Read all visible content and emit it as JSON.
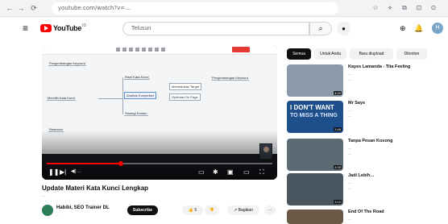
{
  "browser": {
    "address": "youtube.com/watch?v=…",
    "back_icon": "←",
    "forward_icon": "→",
    "reload_icon": "⟳",
    "ext_icons": [
      "☆",
      "⋄",
      "⧉",
      "⊡",
      "⊙"
    ]
  },
  "header": {
    "menu_icon": "≡",
    "logo_text": "YouTube",
    "logo_country": "ID",
    "search_placeholder": "Telusuri",
    "search_icon": "⌕",
    "mic_icon": "●",
    "create_icon": "⊕",
    "bell_icon": "🔔"
  },
  "player": {
    "time": "…",
    "mindmap": {
      "nodes": [
        "Pengembangan Keyword",
        "Memilih Kata Kunci",
        "Research",
        "Riset Kata Kunci",
        "Analisis Kompetitor",
        "Strategi Konten",
        "Menentukan Target",
        "Optimasi On Page"
      ]
    },
    "progress": 0.33,
    "controls": {
      "play_icon": "❚❚",
      "next_icon": "▶|",
      "volume_icon": "◀)",
      "subtitles_icon": "▭",
      "settings_icon": "✱",
      "miniplayer_icon": "▣",
      "theater_icon": "▭",
      "fullscreen_icon": "⛶"
    }
  },
  "video": {
    "title": "Update Materi Kata Kunci Lengkap",
    "subline": "…",
    "channel_name": "Habibi, SEO Trainer DL",
    "channel_subs": "…",
    "subscribe_label": "Subscribe",
    "likes_label": "👍 5",
    "dislike_icon": "👎",
    "share_label": "↗ Bagikan",
    "more_icon": "⋯"
  },
  "chips": [
    "Semua",
    "Untuk Anda",
    "Baru diupload",
    "Ditonton"
  ],
  "recommendations": [
    {
      "title": "Kayes Lamanda - Tita Feeling",
      "meta1": "…",
      "meta2": "…",
      "duration": "4:22",
      "thumb_text": "",
      "thumb_text2": "",
      "color": "#8a9aa8"
    },
    {
      "title": "Mr Says",
      "meta1": "…",
      "meta2": "…",
      "duration": "3:48",
      "thumb_text": "I DON'T WANT",
      "thumb_text2": "TO MISS A THING",
      "color": "#1f4f8a"
    },
    {
      "title": "Tanpa Pesan Kosong",
      "meta1": "…",
      "meta2": "…",
      "duration": "4:05",
      "thumb_text": "",
      "thumb_text2": "",
      "color": "#5c6a73"
    },
    {
      "title": "Jadi Lebih…",
      "meta1": "…",
      "meta2": "…",
      "duration": "3:10",
      "thumb_text": "",
      "thumb_text2": "",
      "color": "#4a5660"
    },
    {
      "title": "End Of The Road",
      "meta1": "…",
      "meta2": "…",
      "duration": "",
      "thumb_text": "",
      "thumb_text2": "",
      "color": "#6b5a48"
    }
  ]
}
